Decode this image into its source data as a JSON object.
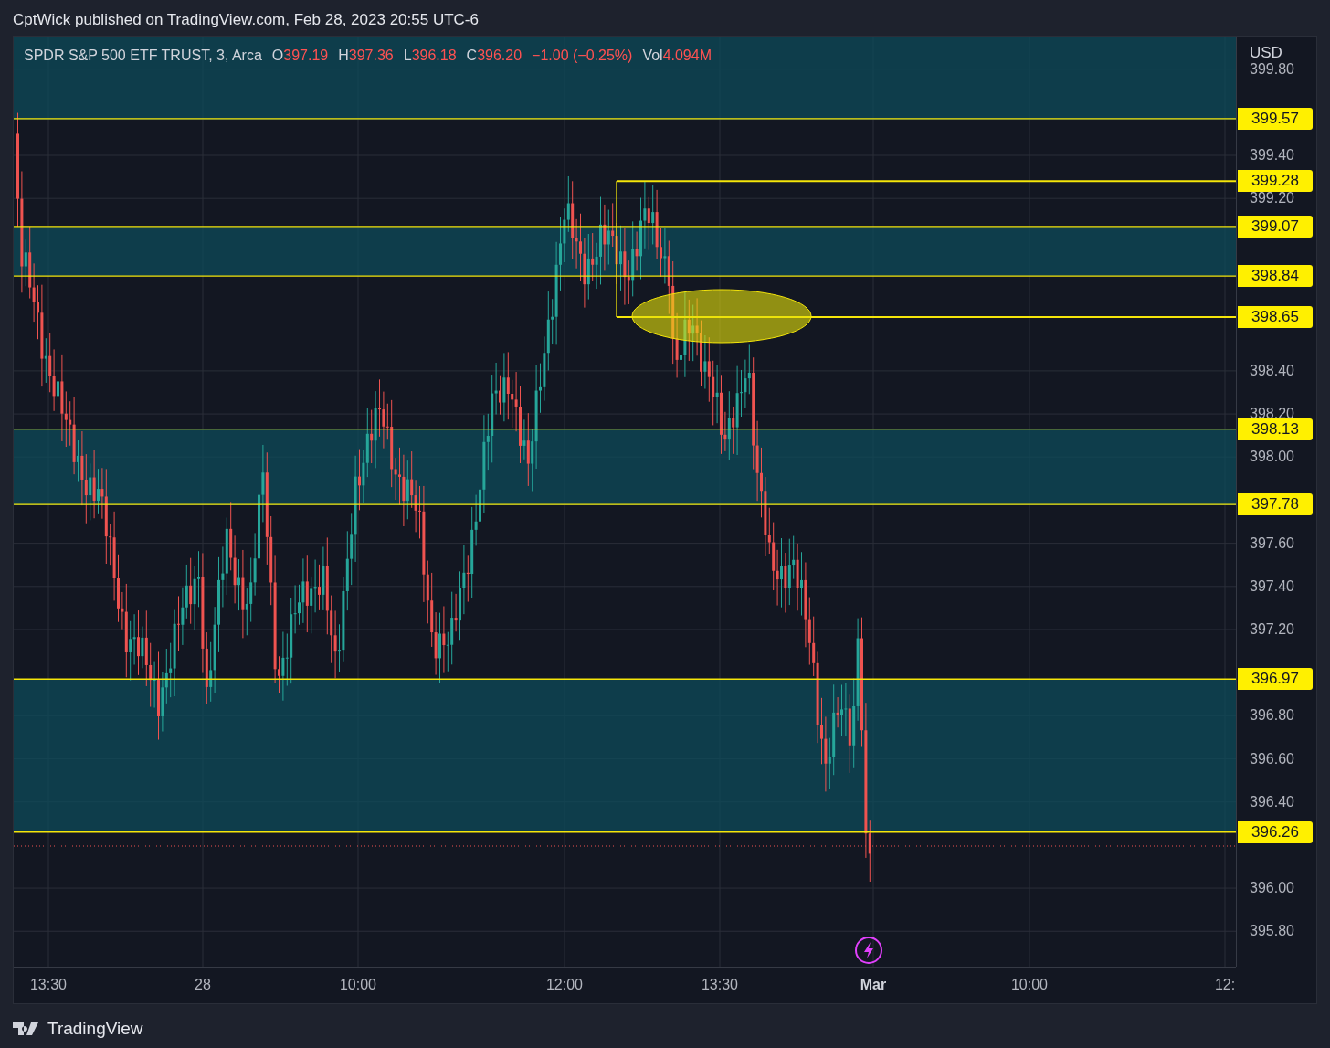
{
  "header": {
    "text": "CptWick published on TradingView.com, Feb 28, 2023 20:55 UTC-6"
  },
  "legend": {
    "symbol": "SPDR S&P 500 ETF TRUST, 3, Arca",
    "fields": [
      {
        "label": "O",
        "value": "397.19"
      },
      {
        "label": "H",
        "value": "397.36"
      },
      {
        "label": "L",
        "value": "396.18"
      },
      {
        "label": "C",
        "value": "396.20"
      },
      {
        "value": "−1.00 (−0.25%)"
      },
      {
        "label": "Vol",
        "value": "4.094M"
      }
    ]
  },
  "price_axis": {
    "currency": "USD",
    "ticks": [
      "399.80",
      "399.40",
      "399.20",
      "398.40",
      "398.20",
      "398.00",
      "397.60",
      "397.40",
      "397.20",
      "396.80",
      "396.60",
      "396.40",
      "396.00",
      "395.80"
    ]
  },
  "levels": [
    {
      "label": "399.57"
    },
    {
      "label": "399.28"
    },
    {
      "label": "399.07"
    },
    {
      "label": "398.84"
    },
    {
      "label": "398.65"
    },
    {
      "label": "398.13"
    },
    {
      "label": "397.78"
    },
    {
      "label": "396.97"
    },
    {
      "label": "396.26"
    }
  ],
  "time_axis": [
    {
      "label": "13:30",
      "kind": "time"
    },
    {
      "label": "28",
      "kind": "day"
    },
    {
      "label": "10:00",
      "kind": "time"
    },
    {
      "label": "12:00",
      "kind": "time"
    },
    {
      "label": "13:30",
      "kind": "time"
    },
    {
      "label": "Mar",
      "kind": "month"
    },
    {
      "label": "10:00",
      "kind": "time"
    },
    {
      "label": "12:",
      "kind": "time"
    }
  ],
  "footer": {
    "brand": "TradingView"
  }
}
